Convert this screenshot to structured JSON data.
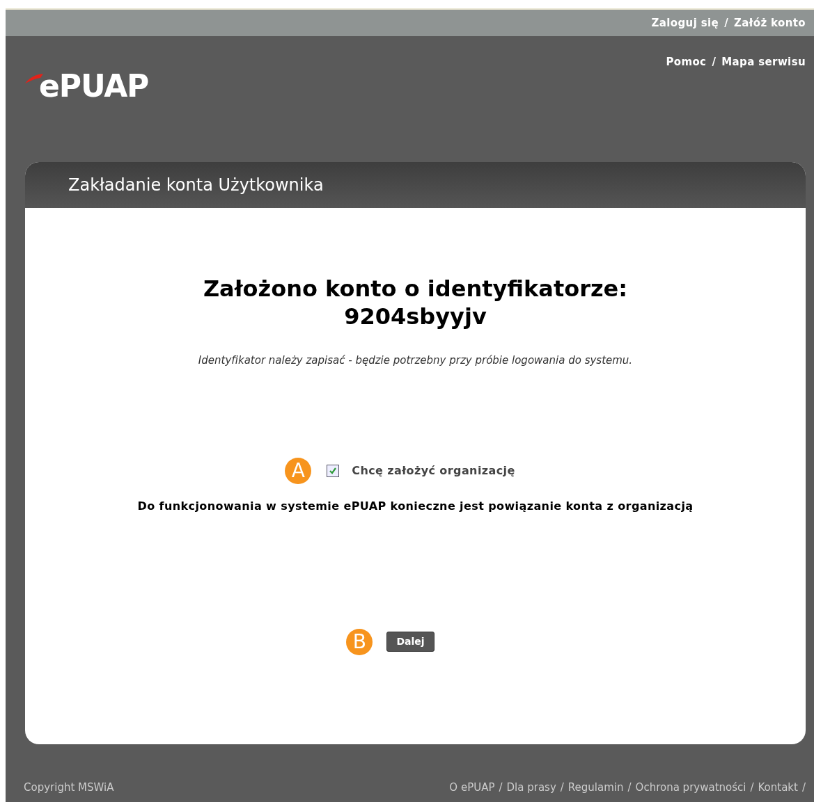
{
  "top_bar": {
    "links": [
      "Zaloguj się",
      "Załóż konto"
    ],
    "separator": "/"
  },
  "header": {
    "logo": "ePUAP",
    "links": [
      "Pomoc",
      "Mapa serwisu"
    ],
    "separator": "/"
  },
  "panel": {
    "title": "Zakładanie konta Użytkownika",
    "heading": [
      "Założono konto o identyfikatorze:",
      "9204sbyyjv"
    ],
    "note": "Identyfikator należy zapisać - będzie potrzebny przy próbie logowania do systemu.",
    "checkbox": {
      "marker": "A",
      "label": "Chcę założyć organizację",
      "checked": true
    },
    "info": "Do funkcjonowania w systemie ePUAP konieczne jest powiązanie konta z organizacją",
    "button": {
      "marker": "B",
      "label": "Dalej"
    }
  },
  "footer": {
    "copyright": "Copyright MSWiA",
    "links": [
      "O ePUAP",
      "Dla prasy",
      "Regulamin",
      "Ochrona prywatności",
      "Kontakt"
    ],
    "separator": "/"
  }
}
